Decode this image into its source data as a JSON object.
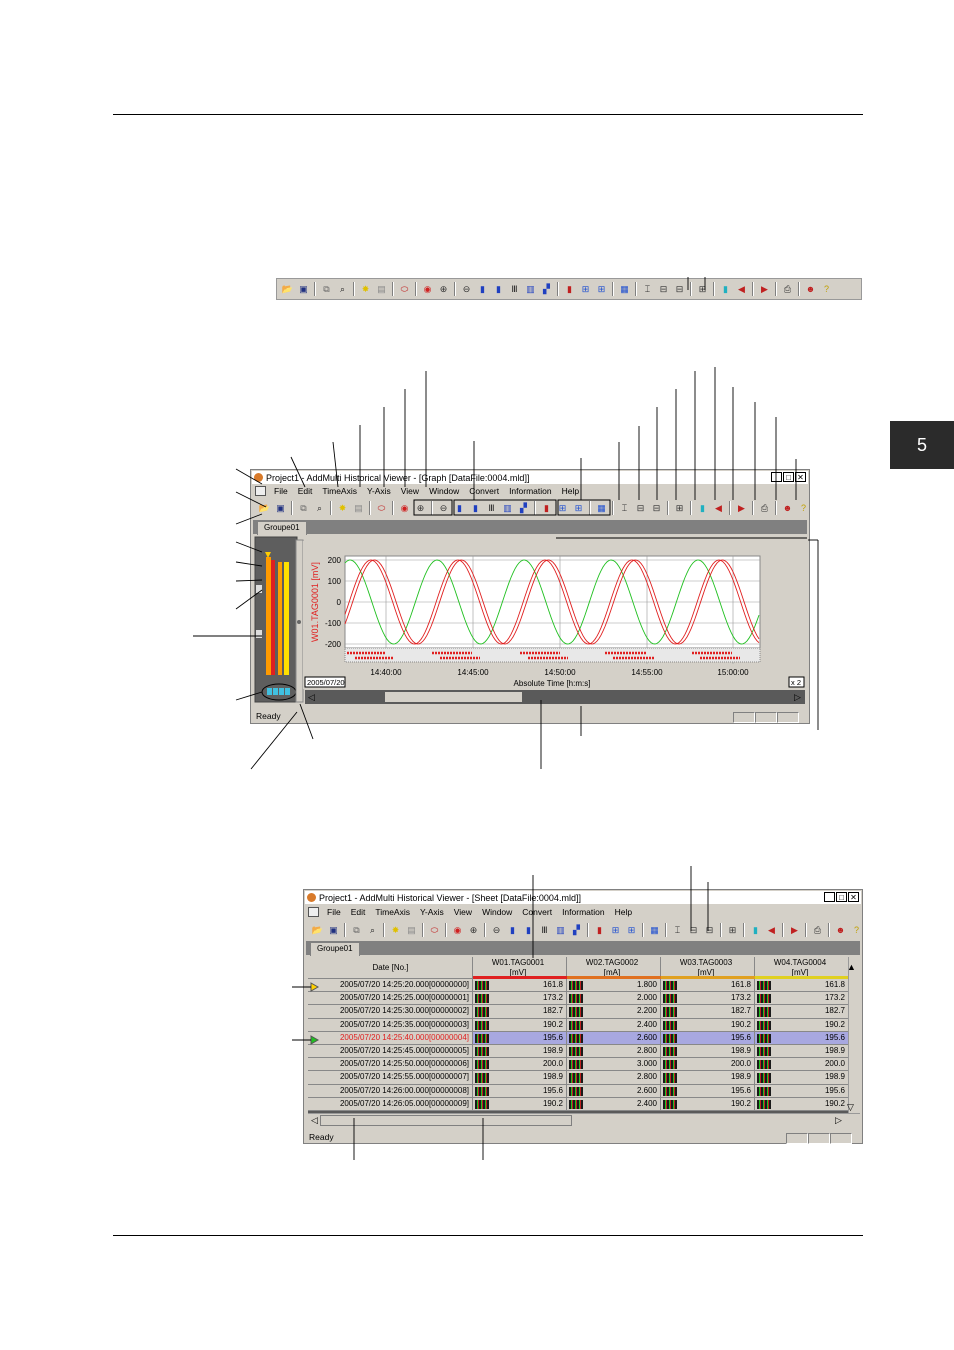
{
  "page": {
    "section_tab": "5"
  },
  "strip_toolbar": {
    "icons": [
      "open-icon",
      "save-icon",
      "copy-icon",
      "find-icon",
      "jump-icon",
      "props-icon",
      "db-icon",
      "cursor-icon",
      "zoom-in-icon",
      "zoom-out-icon",
      "trend-1",
      "trend-2",
      "trend-3",
      "trend-4",
      "trend-5",
      "trend-6",
      "grid-1",
      "grid-2",
      "grid-3",
      "split-1",
      "split-2",
      "split-3",
      "split-4",
      "book-icon",
      "prev-icon",
      "next-icon",
      "print-icon",
      "users-icon",
      "help-icon"
    ]
  },
  "graph_window": {
    "title": "Project1 - AddMulti Historical Viewer - [Graph [DataFile:0004.mld]]",
    "menu": [
      "File",
      "Edit",
      "TimeAxis",
      "Y-Axis",
      "View",
      "Window",
      "Convert",
      "Information",
      "Help"
    ],
    "tab": "Groupe01",
    "status": "Ready",
    "date_box": "2005/07/20",
    "zoom_box": "x 2",
    "y_axis_label": "W01.TAG0001 [mV]",
    "y_ticks": [
      "200",
      "100",
      "0",
      "-100",
      "-200"
    ],
    "x_ticks": [
      "14:40:00",
      "14:45:00",
      "14:50:00",
      "14:55:00",
      "15:00:00"
    ],
    "x_axis_label": "Absolute Time  [h:m:s]"
  },
  "sheet_window": {
    "title": "Project1 - AddMulti Historical Viewer - [Sheet [DataFile:0004.mld]]",
    "menu": [
      "File",
      "Edit",
      "TimeAxis",
      "Y-Axis",
      "View",
      "Window",
      "Convert",
      "Information",
      "Help"
    ],
    "tab": "Groupe01",
    "status": "Ready",
    "date_header": "Date [No.]",
    "columns": [
      {
        "name": "W01.TAG0001",
        "unit": "[mV]",
        "color": "#e02020"
      },
      {
        "name": "W02.TAG0002",
        "unit": "[mA]",
        "color": "#e07020"
      },
      {
        "name": "W03.TAG0003",
        "unit": "[mV]",
        "color": "#e0a020"
      },
      {
        "name": "W04.TAG0004",
        "unit": "[mV]",
        "color": "#e0d020"
      }
    ],
    "rows": [
      {
        "date": "2005/07/20 14:25:20.000[00000000]",
        "v": [
          "161.8",
          "1.800",
          "161.8",
          "161.8"
        ]
      },
      {
        "date": "2005/07/20 14:25:25.000[00000001]",
        "v": [
          "173.2",
          "2.000",
          "173.2",
          "173.2"
        ]
      },
      {
        "date": "2005/07/20 14:25:30.000[00000002]",
        "v": [
          "182.7",
          "2.200",
          "182.7",
          "182.7"
        ]
      },
      {
        "date": "2005/07/20 14:25:35.000[00000003]",
        "v": [
          "190.2",
          "2.400",
          "190.2",
          "190.2"
        ]
      },
      {
        "date": "2005/07/20 14:25:40.000[00000004]",
        "v": [
          "195.6",
          "2.600",
          "195.6",
          "195.6"
        ],
        "selected": true
      },
      {
        "date": "2005/07/20 14:25:45.000[00000005]",
        "v": [
          "198.9",
          "2.800",
          "198.9",
          "198.9"
        ]
      },
      {
        "date": "2005/07/20 14:25:50.000[00000006]",
        "v": [
          "200.0",
          "3.000",
          "200.0",
          "200.0"
        ]
      },
      {
        "date": "2005/07/20 14:25:55.000[00000007]",
        "v": [
          "198.9",
          "2.800",
          "198.9",
          "198.9"
        ]
      },
      {
        "date": "2005/07/20 14:26:00.000[00000008]",
        "v": [
          "195.6",
          "2.600",
          "195.6",
          "195.6"
        ]
      },
      {
        "date": "2005/07/20 14:26:05.000[00000009]",
        "v": [
          "190.2",
          "2.400",
          "190.2",
          "190.2"
        ]
      }
    ]
  }
}
